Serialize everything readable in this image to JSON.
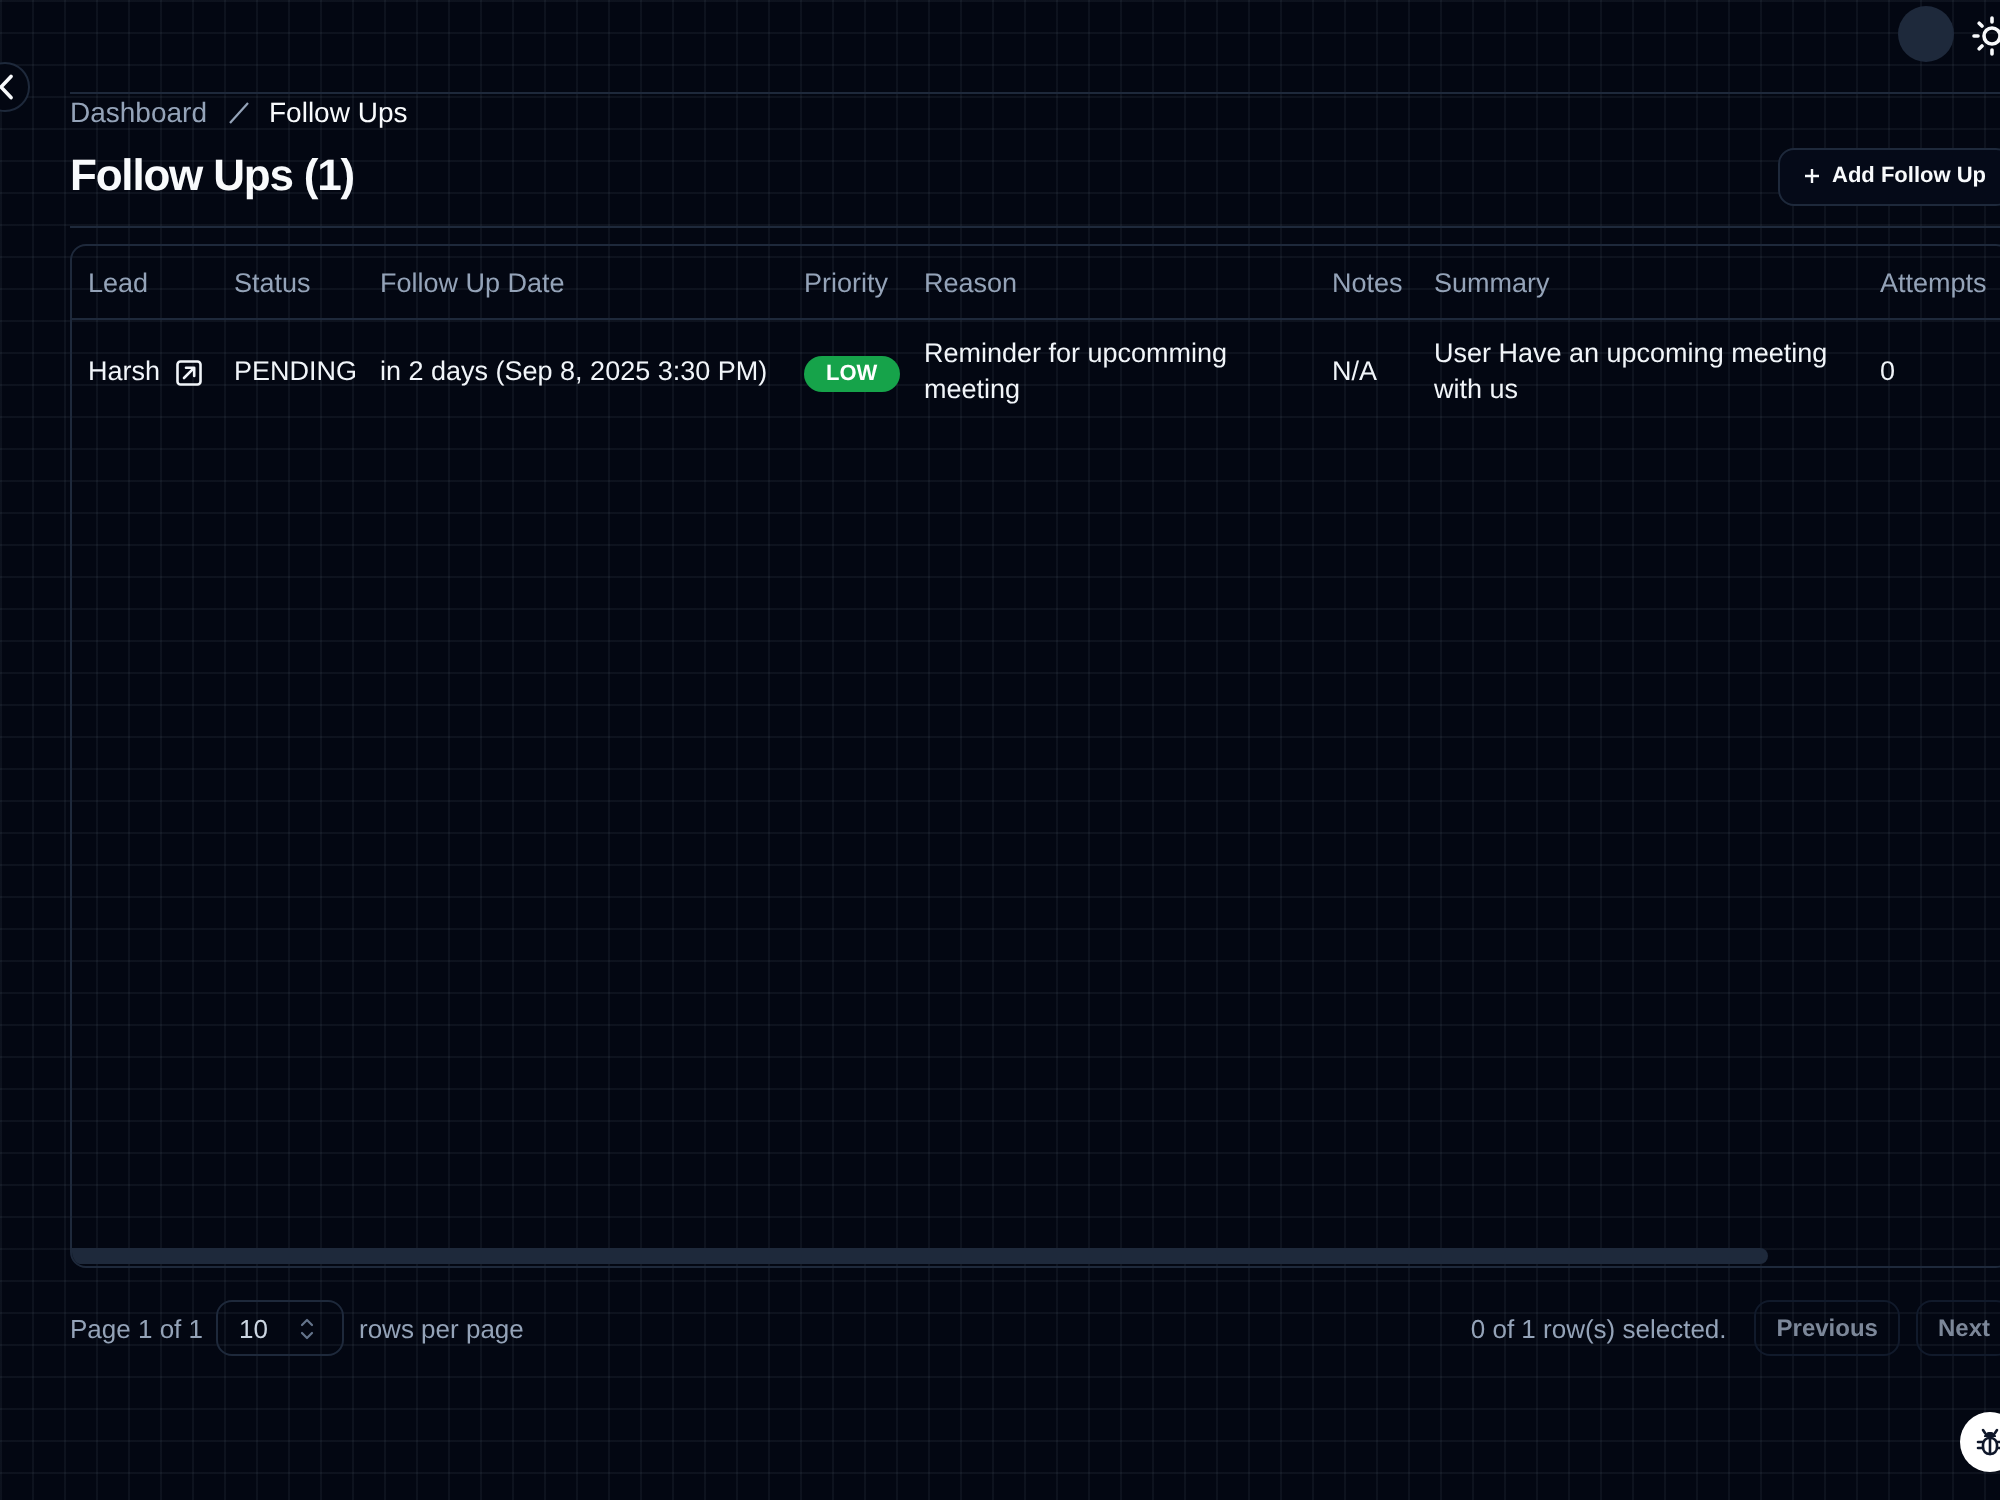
{
  "breadcrumb": [
    {
      "label": "Dashboard",
      "current": false
    },
    {
      "label": "Follow Ups",
      "current": true
    }
  ],
  "page": {
    "title": "Follow Ups (1)",
    "add_button": "Add Follow Up"
  },
  "table": {
    "columns": [
      "Lead",
      "Status",
      "Follow Up Date",
      "Priority",
      "Reason",
      "Notes",
      "Summary",
      "Attempts"
    ],
    "rows": [
      {
        "lead": "Harsh",
        "status": "PENDING",
        "follow_up_date": "in 2 days (Sep 8, 2025 3:30 PM)",
        "priority": {
          "label": "LOW",
          "color": "#16a34a"
        },
        "reason": "Reminder for upcomming meeting",
        "notes": "N/A",
        "summary": "User Have an upcoming meeting with us",
        "attempts": "0"
      }
    ]
  },
  "pagination": {
    "page_info": "Page 1 of 1",
    "rows_per_page": "10",
    "rows_per_page_label": "rows per page",
    "selection_info": "0 of 1 row(s) selected.",
    "buttons": [
      {
        "label": "Previous",
        "disabled": true
      },
      {
        "label": "Next",
        "disabled": true
      }
    ]
  }
}
